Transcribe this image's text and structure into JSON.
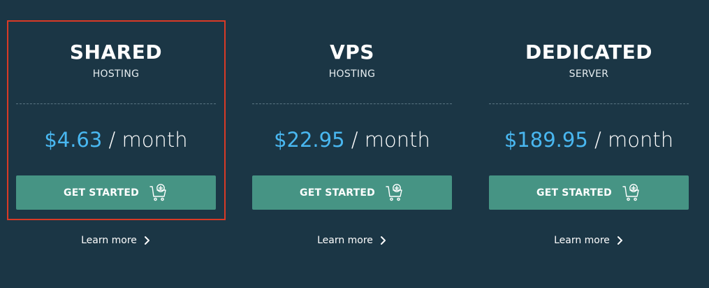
{
  "plans": [
    {
      "title": "SHARED",
      "subtitle": "HOSTING",
      "price": "$4.63",
      "period": " / month",
      "button_label": "GET STARTED",
      "learn_more": "Learn more",
      "highlighted": true
    },
    {
      "title": "VPS",
      "subtitle": "HOSTING",
      "price": "$22.95",
      "period": " / month",
      "button_label": "GET STARTED",
      "learn_more": "Learn more",
      "highlighted": false
    },
    {
      "title": "DEDICATED",
      "subtitle": "SERVER",
      "price": "$189.95",
      "period": " / month",
      "button_label": "GET STARTED",
      "learn_more": "Learn more",
      "highlighted": false
    }
  ],
  "icons": {
    "cart": "cart-plus-icon",
    "chevron": "chevron-right-icon"
  },
  "colors": {
    "background": "#1b3645",
    "price_accent": "#49b7f0",
    "button": "#469484",
    "highlight_border": "#d93a26"
  }
}
